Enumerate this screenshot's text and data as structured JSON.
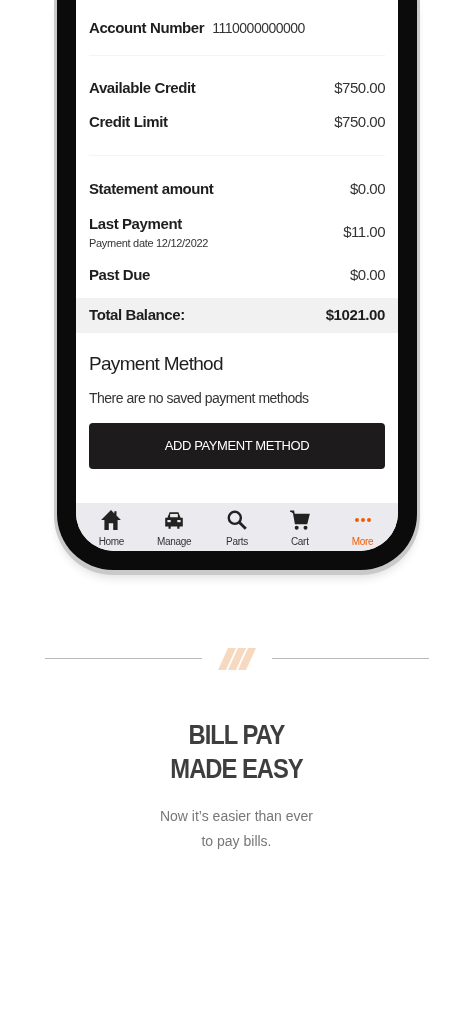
{
  "account": {
    "label": "Account Number",
    "number": "1110000000000"
  },
  "credit": [
    {
      "label": "Available Credit",
      "value": "$750.00"
    },
    {
      "label": "Credit Limit",
      "value": "$750.00"
    }
  ],
  "summary": [
    {
      "label": "Statement amount",
      "value": "$0.00"
    },
    {
      "label": "Last Payment",
      "sub": "Payment date 12/12/2022",
      "value": "$11.00"
    },
    {
      "label": "Past Due",
      "value": "$0.00"
    }
  ],
  "total": {
    "label": "Total Balance:",
    "value": "$1021.00"
  },
  "payment_method": {
    "title": "Payment Method",
    "message": "There are no saved payment methods",
    "button": "ADD PAYMENT METHOD"
  },
  "tab_bar": [
    {
      "label": "Home",
      "selected": false
    },
    {
      "label": "Manage",
      "selected": false
    },
    {
      "label": "Parts",
      "selected": false
    },
    {
      "label": "Cart",
      "selected": false
    },
    {
      "label": "More",
      "selected": true
    }
  ],
  "promo": {
    "headline": [
      "BILL PAY",
      "MADE EASY"
    ],
    "text": "Now it’s easier than ever to pay bills."
  }
}
